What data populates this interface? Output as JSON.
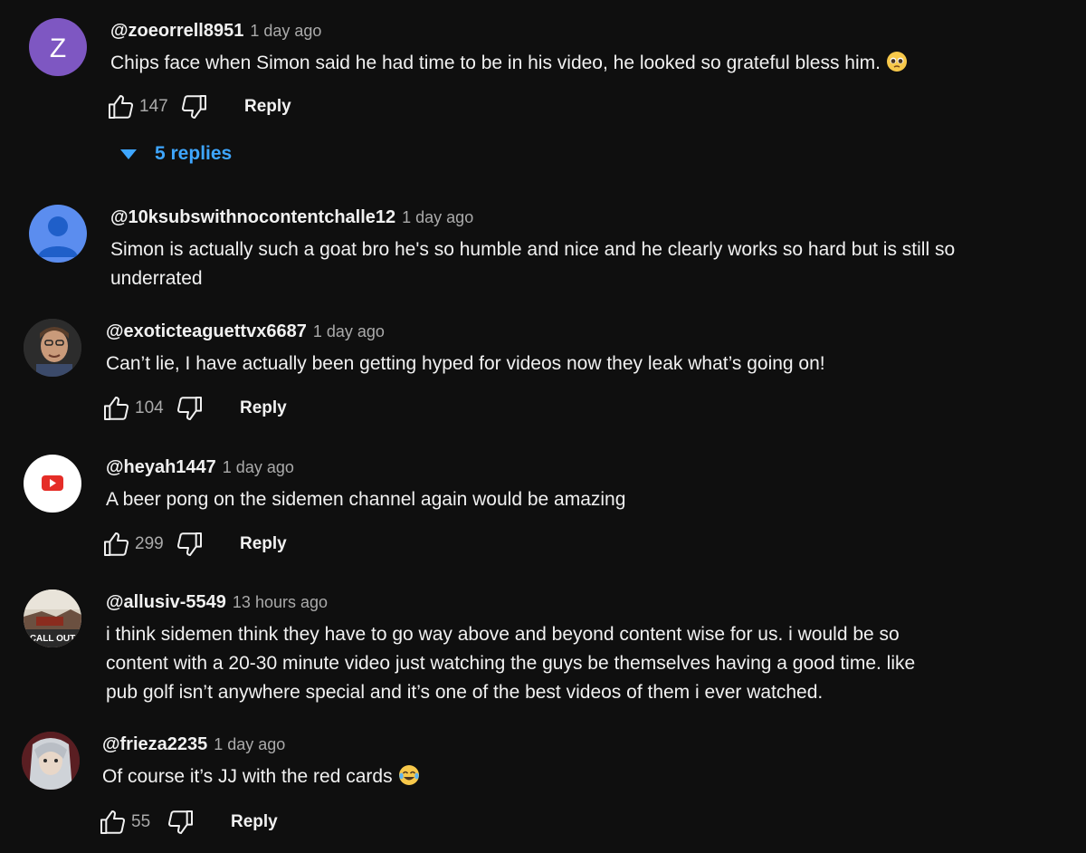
{
  "comments": [
    {
      "author": "@zoeorrell8951",
      "time": "1 day ago",
      "text": "Chips face when Simon said he had time to be in his video, he looked so grateful bless him.",
      "emoji": "pleading-face-emoji",
      "avatar_letter": "Z",
      "avatar_color": "#7e57c2",
      "likes": "147",
      "reply_label": "Reply",
      "replies_label": "5 replies"
    },
    {
      "author": "@10ksubswithnocontentchalle12",
      "time": "1 day ago",
      "text_lines": [
        "Simon is actually such a goat bro he's so humble and nice and he clearly works so hard but is still so",
        "underrated"
      ],
      "avatar_icon": "default-user-icon",
      "avatar_color": "#5b8def"
    },
    {
      "author": "@exoticteaguettvx6687",
      "time": "1 day ago",
      "text": "Can’t lie, I have actually been getting hyped for videos now they leak what’s going on!",
      "avatar_icon": "photo-avatar",
      "likes": "104",
      "reply_label": "Reply"
    },
    {
      "author": "@heyah1447",
      "time": "1 day ago",
      "text": "A beer pong on the sidemen channel again would be amazing",
      "avatar_icon": "youtube-logo-icon",
      "likes": "299",
      "reply_label": "Reply"
    },
    {
      "author": "@allusiv-5549",
      "time": "13 hours ago",
      "text_lines": [
        "i think sidemen think they have to go way above and beyond content wise for us. i would be so",
        "content with a 20-30 minute video just watching the guys be themselves having a good time. like",
        "pub golf isn’t anywhere special and it’s one of the best videos of them i ever watched."
      ],
      "avatar_icon": "photo-avatar",
      "avatar_text": "CALL OUT"
    },
    {
      "author": "@frieza2235",
      "time": "1 day ago",
      "text": "Of course it’s JJ with the red cards",
      "emoji": "tears-of-joy-emoji",
      "avatar_icon": "photo-avatar",
      "likes": "55",
      "reply_label": "Reply"
    }
  ],
  "colors": {
    "background": "#0f0f0f",
    "text": "#f1f1f1",
    "secondary": "#aaaaaa",
    "link": "#3ea6ff"
  }
}
